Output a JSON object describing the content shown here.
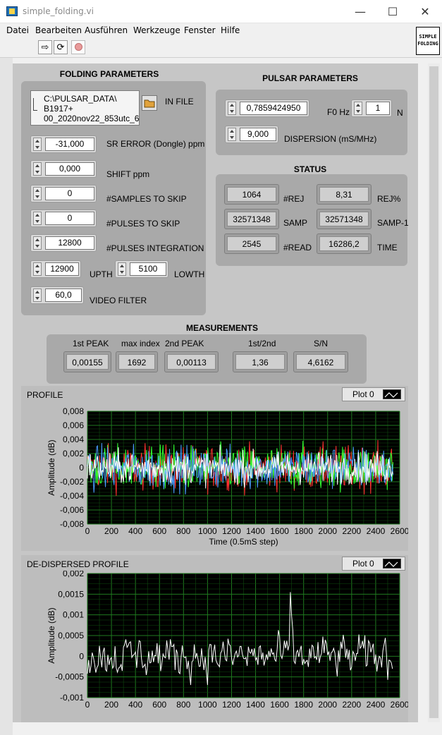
{
  "window": {
    "title": "simple_folding.vi",
    "minimize": "—",
    "maximize": "☐",
    "close": "✕"
  },
  "menu": [
    "Datei",
    "Bearbeiten",
    "Ausführen",
    "Werkzeuge",
    "Fenster",
    "Hilfe"
  ],
  "toolbar": {
    "run_icon": "run-arrow-icon",
    "run_continuous_icon": "run-continuously-icon",
    "abort_icon": "abort-icon"
  },
  "vi_icon": {
    "line1": "SIMPLE",
    "line2": "FOLDING"
  },
  "folding": {
    "title": "FOLDING PARAMETERS",
    "in_file": {
      "label": "IN FILE",
      "line1": "C:\\PULSAR_DATA\\",
      "line2": "B1917+",
      "line3": "00_2020nov22_853utc_6b"
    },
    "sr_error": {
      "label": "SR ERROR (Dongle) ppm",
      "value": "-31,000"
    },
    "shift": {
      "label": "SHIFT ppm",
      "value": "0,000"
    },
    "samples_skip": {
      "label": "#SAMPLES TO SKIP",
      "value": "0"
    },
    "pulses_skip": {
      "label": "#PULSES TO SKIP",
      "value": "0"
    },
    "pulses_integration": {
      "label": "#PULSES INTEGRATION",
      "value": "12800"
    },
    "upth": {
      "label": "UPTH",
      "value": "12900"
    },
    "lowth": {
      "label": "LOWTH",
      "value": "5100"
    },
    "video_filter": {
      "label": "VIDEO FILTER",
      "value": "60,0"
    }
  },
  "pulsar": {
    "title": "PULSAR PARAMETERS",
    "f0": {
      "label": "F0 Hz",
      "value": "0,7859424950"
    },
    "n": {
      "label": "N",
      "value": "1"
    },
    "dispersion": {
      "label": "DISPERSION (mS/MHz)",
      "value": "9,000"
    }
  },
  "status": {
    "title": "STATUS",
    "rej": {
      "label": "#REJ",
      "value": "1064"
    },
    "rej_pct": {
      "label": "REJ%",
      "value": "8,31"
    },
    "samp": {
      "label": "SAMP",
      "value": "32571348"
    },
    "samp1": {
      "label": "SAMP-1",
      "value": "32571348"
    },
    "read": {
      "label": "#READ",
      "value": "2545"
    },
    "time": {
      "label": "TIME",
      "value": "16286,2"
    }
  },
  "measurements": {
    "title": "MEASUREMENTS",
    "peak1": {
      "label": "1st PEAK",
      "value": "0,00155"
    },
    "max_index": {
      "label": "max index",
      "value": "1692"
    },
    "peak2": {
      "label": "2nd PEAK",
      "value": "0,00113"
    },
    "ratio": {
      "label": "1st/2nd",
      "value": "1,36"
    },
    "sn": {
      "label": "S/N",
      "value": "4,6162"
    }
  },
  "chart_data": [
    {
      "type": "line",
      "title": "PROFILE",
      "legend": "Plot 0",
      "xlabel": "Time (0.5mS step)",
      "ylabel": "Amplitude (dB)",
      "xlim": [
        0,
        2600
      ],
      "ylim": [
        -0.008,
        0.008
      ],
      "xticks": [
        "0",
        "200",
        "400",
        "600",
        "800",
        "1000",
        "1200",
        "1400",
        "1600",
        "1800",
        "2000",
        "2200",
        "2400",
        "2600"
      ],
      "yticks": [
        "-0,008",
        "-0,006",
        "-0,004",
        "-0,002",
        "0",
        "0,002",
        "0,004",
        "0,006",
        "0,008"
      ],
      "grid": true,
      "series_colors": [
        "#ff3030",
        "#30ff30",
        "#4a9cff",
        "#ffffff"
      ],
      "x_extent": [
        0,
        2545
      ],
      "amplitude_envelope": 0.0045
    },
    {
      "type": "line",
      "title": "DE-DISPERSED PROFILE",
      "legend": "Plot 0",
      "xlabel": "",
      "ylabel": "Amplitude (dB)",
      "xlim": [
        0,
        2600
      ],
      "ylim": [
        -0.001,
        0.002
      ],
      "xticks": [
        "0",
        "200",
        "400",
        "600",
        "800",
        "1000",
        "1200",
        "1400",
        "1600",
        "1800",
        "2000",
        "2200",
        "2400",
        "2600"
      ],
      "yticks": [
        "-0,001",
        "-0,0005",
        "0",
        "0,0005",
        "0,001",
        "0,0015",
        "0,002"
      ],
      "grid": true,
      "series_colors": [
        "#ffffff"
      ],
      "peak": {
        "x": 1692,
        "y": 0.00155
      },
      "x_extent": [
        0,
        2545
      ]
    }
  ],
  "colors": {
    "panel": "#c6c6c6",
    "group": "#a9a9a9",
    "plot_bg": "#000000",
    "grid": "#1f7a1f"
  }
}
